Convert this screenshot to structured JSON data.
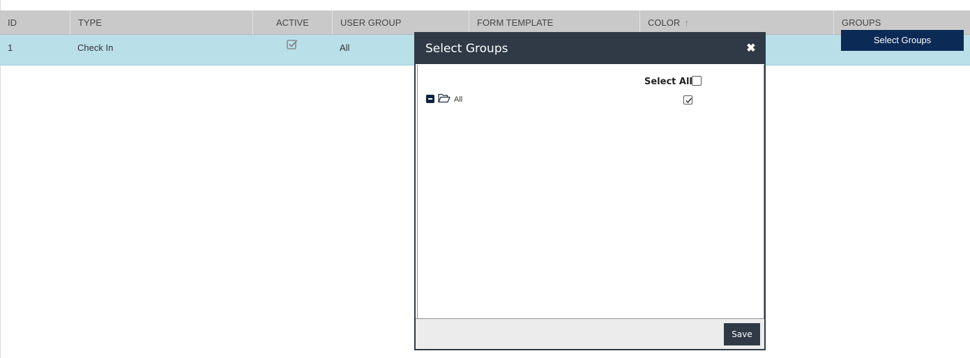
{
  "grid": {
    "columns": [
      "ID",
      "TYPE",
      "ACTIVE",
      "USER GROUP",
      "FORM TEMPLATE",
      "COLOR",
      "GROUPS"
    ],
    "sorted_column": "COLOR",
    "sort_icon": "sort-arrow-up-icon",
    "rows": [
      {
        "id": "1",
        "type": "Check In",
        "active": true,
        "user_group": "All",
        "form_template": "",
        "color": "",
        "groups_button": "Select Groups"
      }
    ]
  },
  "modal": {
    "title": "Select Groups",
    "close_icon": "close-icon",
    "select_all_label": "Select All",
    "select_all_checked": false,
    "tree": [
      {
        "label": "All",
        "expanded": true,
        "checked": true,
        "icon": "folder-open-icon"
      }
    ],
    "save_label": "Save"
  },
  "colors": {
    "header_bg": "#c9c9c9",
    "row_selected_bg": "#b9dfe9",
    "button_navy": "#0b2a55",
    "modal_dark": "#2f3a46",
    "footer_bg": "#ececec"
  }
}
